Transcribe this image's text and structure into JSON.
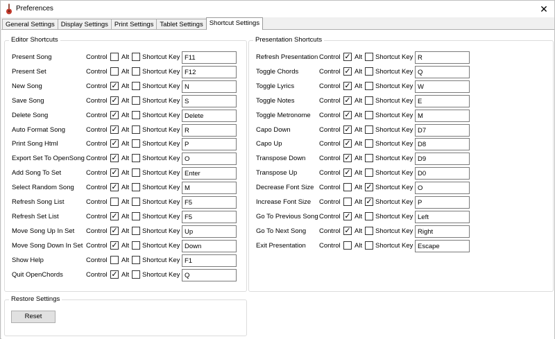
{
  "window": {
    "title": "Preferences",
    "close_label": "✕"
  },
  "tabs": [
    {
      "label": "General Settings",
      "active": false
    },
    {
      "label": "Display Settings",
      "active": false
    },
    {
      "label": "Print Settings",
      "active": false
    },
    {
      "label": "Tablet Settings",
      "active": false
    },
    {
      "label": "Shortcut Settings",
      "active": true
    }
  ],
  "labels": {
    "control": "Control",
    "alt": "Alt",
    "shortcut_key": "Shortcut Key"
  },
  "editor": {
    "title": "Editor Shortcuts",
    "rows": [
      {
        "name": "Present Song",
        "control": false,
        "alt": false,
        "key": "F11"
      },
      {
        "name": "Present Set",
        "control": false,
        "alt": false,
        "key": "F12"
      },
      {
        "name": "New Song",
        "control": true,
        "alt": false,
        "key": "N"
      },
      {
        "name": "Save Song",
        "control": true,
        "alt": false,
        "key": "S"
      },
      {
        "name": "Delete Song",
        "control": true,
        "alt": false,
        "key": "Delete"
      },
      {
        "name": "Auto Format Song",
        "control": true,
        "alt": false,
        "key": "R"
      },
      {
        "name": "Print Song Html",
        "control": true,
        "alt": false,
        "key": "P"
      },
      {
        "name": "Export Set To OpenSong",
        "control": true,
        "alt": false,
        "key": "O"
      },
      {
        "name": "Add Song To Set",
        "control": true,
        "alt": false,
        "key": "Enter"
      },
      {
        "name": "Select Random Song",
        "control": true,
        "alt": false,
        "key": "M"
      },
      {
        "name": "Refresh Song List",
        "control": false,
        "alt": false,
        "key": "F5"
      },
      {
        "name": "Refresh Set List",
        "control": true,
        "alt": false,
        "key": "F5"
      },
      {
        "name": "Move Song Up In Set",
        "control": true,
        "alt": false,
        "key": "Up"
      },
      {
        "name": "Move Song Down In Set",
        "control": true,
        "alt": false,
        "key": "Down"
      },
      {
        "name": "Show Help",
        "control": false,
        "alt": false,
        "key": "F1"
      },
      {
        "name": "Quit OpenChords",
        "control": true,
        "alt": false,
        "key": "Q"
      }
    ]
  },
  "presentation": {
    "title": "Presentation Shortcuts",
    "rows": [
      {
        "name": "Refresh Presentation",
        "control": true,
        "alt": false,
        "key": "R"
      },
      {
        "name": "Toggle Chords",
        "control": true,
        "alt": false,
        "key": "Q"
      },
      {
        "name": "Toggle Lyrics",
        "control": true,
        "alt": false,
        "key": "W"
      },
      {
        "name": "Toggle Notes",
        "control": true,
        "alt": false,
        "key": "E"
      },
      {
        "name": "Toggle Metronome",
        "control": true,
        "alt": false,
        "key": "M"
      },
      {
        "name": "Capo Down",
        "control": true,
        "alt": false,
        "key": "D7"
      },
      {
        "name": "Capo Up",
        "control": true,
        "alt": false,
        "key": "D8"
      },
      {
        "name": "Transpose Down",
        "control": true,
        "alt": false,
        "key": "D9"
      },
      {
        "name": "Transpose Up",
        "control": true,
        "alt": false,
        "key": "D0"
      },
      {
        "name": "Decrease Font Size",
        "control": false,
        "alt": true,
        "key": "O"
      },
      {
        "name": "Increase Font Size",
        "control": false,
        "alt": true,
        "key": "P"
      },
      {
        "name": "Go To Previous Song",
        "control": true,
        "alt": false,
        "key": "Left"
      },
      {
        "name": "Go To Next Song",
        "control": true,
        "alt": false,
        "key": "Right"
      },
      {
        "name": "Exit Presentation",
        "control": false,
        "alt": false,
        "key": "Escape"
      }
    ]
  },
  "restore": {
    "title": "Restore Settings",
    "reset_label": "Reset"
  }
}
